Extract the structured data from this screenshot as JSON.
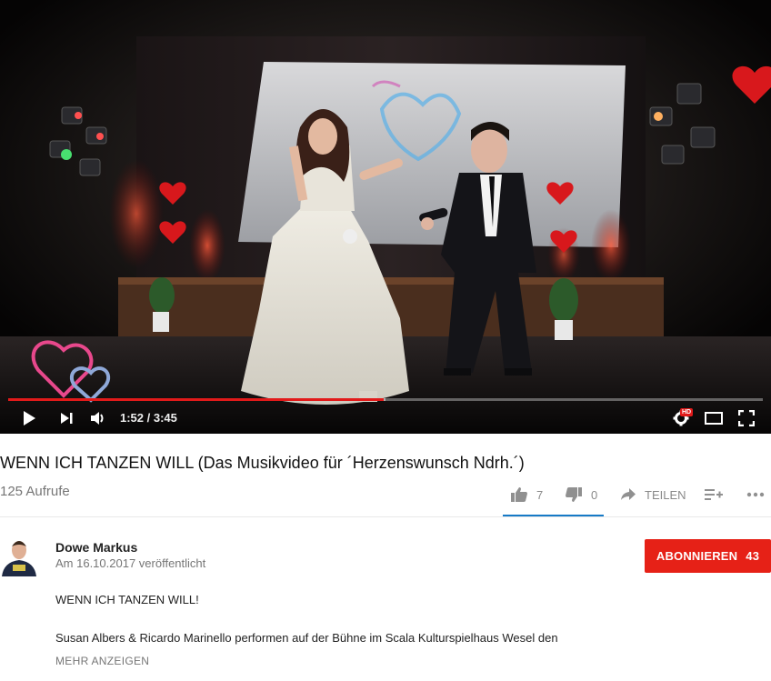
{
  "player": {
    "time_current": "1:52",
    "time_total": "3:45",
    "time_display": "1:52 / 3:45",
    "progress_fraction": 0.498,
    "buffered_fraction": 0.5,
    "hd_badge": "HD",
    "accent_color": "#e21a1a"
  },
  "video": {
    "title": "WENN ICH TANZEN WILL (Das Musikvideo für ´Herzenswunsch Ndrh.´)",
    "views": "125 Aufrufe"
  },
  "actions": {
    "like_count": "7",
    "dislike_count": "0",
    "share_label": "TEILEN"
  },
  "channel": {
    "name": "Dowe Markus",
    "published": "Am 16.10.2017 veröffentlicht"
  },
  "subscribe": {
    "label": "ABONNIEREN",
    "count": "43",
    "color": "#e62117"
  },
  "description": {
    "line1": "WENN ICH TANZEN WILL!",
    "line2": "Susan Albers & Ricardo Marinello performen auf der Bühne im Scala Kulturspielhaus Wesel den",
    "more_label": "MEHR ANZEIGEN"
  },
  "icons": {
    "play": "play-icon",
    "next": "next-icon",
    "volume": "volume-icon",
    "settings": "settings-gear-icon",
    "theater": "theater-mode-icon",
    "fullscreen": "fullscreen-icon",
    "like": "thumbs-up-icon",
    "dislike": "thumbs-down-icon",
    "share": "share-arrow-icon",
    "add_to": "add-to-playlist-icon",
    "more": "more-horizontal-icon"
  }
}
